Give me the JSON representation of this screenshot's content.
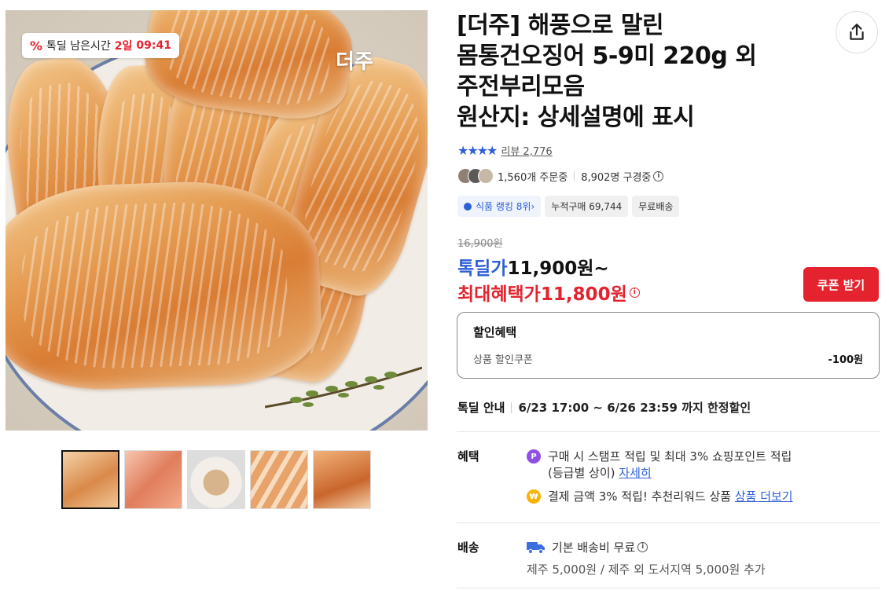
{
  "gallery": {
    "timer_prefix": "%",
    "timer_label": "톡딜 남은시간",
    "timer_days": "2일",
    "timer_time": "09:41",
    "brand_logo": "더주",
    "thumbnail_count": 5
  },
  "product": {
    "title_lines": [
      "[더주] 해풍으로 말린",
      "몸통건오징어 5-9미 220g 외",
      "주전부리모음",
      "원산지: 상세설명에 표시"
    ],
    "stars": "★★★★",
    "review_text": "리뷰 2,776",
    "orders_text": "1,560개 주문중",
    "viewers_text": "8,902명 구경중",
    "tags": {
      "ranking": "식품 랭킹 8위",
      "cumulative": "누적구매 69,744",
      "shipping": "무료배송"
    }
  },
  "price": {
    "original": "16,900원",
    "deal_label": "톡딜가",
    "deal_value": "11,900원~",
    "max_label": "최대혜택가",
    "max_value": "11,800원",
    "coupon_button": "쿠폰 받기"
  },
  "discount": {
    "heading": "할인혜택",
    "item_label": "상품 할인쿠폰",
    "item_amount": "-100원"
  },
  "deal_info": {
    "label": "톡딜 안내",
    "period": "6/23 17:00 ~ 6/26 23:59 까지 한정할인"
  },
  "benefits": {
    "label": "혜택",
    "line1": "구매 시 스탬프 적립 및 최대 3% 쇼핑포인트 적립",
    "line1b": "(등급별 상이)",
    "line1_link": "자세히",
    "line2": "결제 금액 3% 적립! 추천리워드 상품",
    "line2_link": "상품 더보기"
  },
  "shipping": {
    "label": "배송",
    "line1": "기본 배송비 무료",
    "line2": "제주 5,000원 / 제주 외 도서지역 5,000원 추가"
  },
  "colors": {
    "accent_blue": "#2e5fd6",
    "accent_red": "#e4232e"
  }
}
